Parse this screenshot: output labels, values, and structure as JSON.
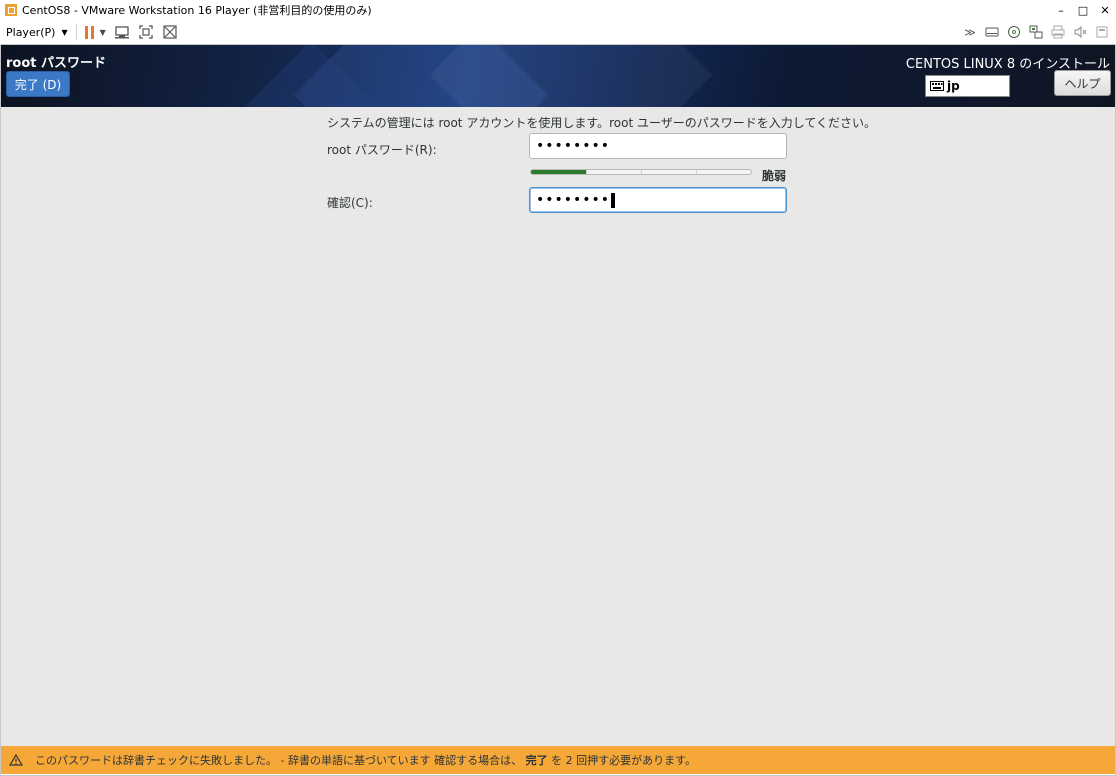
{
  "window": {
    "title": "CentOS8 - VMware Workstation 16 Player (非営利目的の使用のみ)",
    "controls": {
      "minimize": "–",
      "maximize": "□",
      "close": "✕"
    }
  },
  "toolbar": {
    "player_menu": "Player(P)",
    "right_icons": [
      "double-chevron-icon",
      "drive-icon",
      "cd-icon",
      "network-icon",
      "printer-icon",
      "sound-icon",
      "message-icon"
    ]
  },
  "header": {
    "spoke_title": "root パスワード",
    "done_label": "完了 (D)",
    "install_title": "CENTOS LINUX 8 のインストール",
    "keyboard_layout": "jp",
    "help_label": "ヘルプ"
  },
  "form": {
    "intro": "システムの管理には root アカウントを使用します。root ユーザーのパスワードを入力してください。",
    "password_label": "root パスワード(R):",
    "password_value": "••••••••",
    "strength_label": "脆弱",
    "strength_fraction": 0.25,
    "confirm_label": "確認(C):",
    "confirm_value": "••••••••"
  },
  "warning": {
    "text_before": "このパスワードは辞書チェックに失敗しました。 - 辞書の単語に基づいています 確認する場合は、",
    "bold": "完了",
    "text_after": "を 2 回押す必要があります。"
  },
  "colors": {
    "done_button": "#3b79c6",
    "warning_bar": "#f5a838",
    "strength_fill": "#2c7a2c",
    "pause_icon": "#e8762c"
  }
}
